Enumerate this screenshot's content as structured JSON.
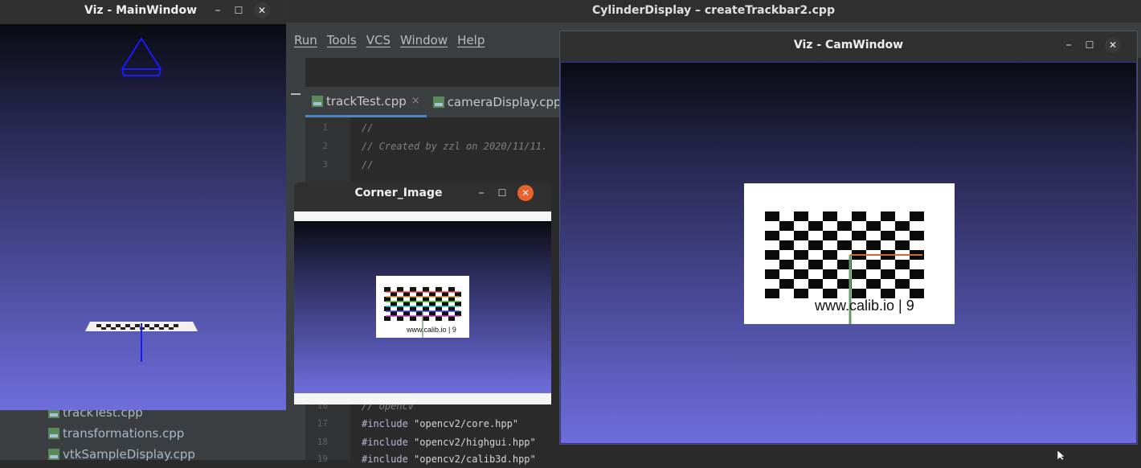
{
  "ide": {
    "title": "CylinderDisplay – createTrackbar2.cpp",
    "menu": [
      "Run",
      "Tools",
      "VCS",
      "Window",
      "Help"
    ],
    "tabs": [
      {
        "label": "trackTest.cpp",
        "close": "×"
      },
      {
        "label": "cameraDisplay.cpp"
      }
    ],
    "code_lines": [
      {
        "num": "1",
        "text": "//",
        "comment": true
      },
      {
        "num": "2",
        "text": "// Created by zzl on 2020/11/11.",
        "comment": true
      },
      {
        "num": "3",
        "text": "//",
        "comment": true
      },
      {
        "num": "16",
        "text": "// opencv",
        "comment": true
      },
      {
        "num": "17",
        "pre": "#include",
        "str": "\"opencv2/core.hpp\""
      },
      {
        "num": "18",
        "pre": "#include",
        "str": "\"opencv2/highgui.hpp\""
      },
      {
        "num": "19",
        "pre": "#include",
        "str": "\"opencv2/calib3d.hpp\""
      }
    ],
    "project_files": [
      "trackTest.cpp",
      "transformations.cpp",
      "vtkSampleDisplay.cpp"
    ]
  },
  "main_window": {
    "title": "Viz - MainWindow",
    "min": "–",
    "max": "☐",
    "close": "✕"
  },
  "cam_window": {
    "title": "Viz - CamWindow",
    "min": "–",
    "max": "☐",
    "close": "✕",
    "pattern_text": "www.calib.io | 9"
  },
  "corner_window": {
    "title": "Corner_Image",
    "min": "–",
    "max": "☐",
    "close": "✕",
    "pattern_text": "www.calib.io | 9"
  },
  "colors": {
    "accent_close": "#e9622b",
    "viz_bottom": "#6e6edc",
    "viz_top": "#0b0b14"
  }
}
